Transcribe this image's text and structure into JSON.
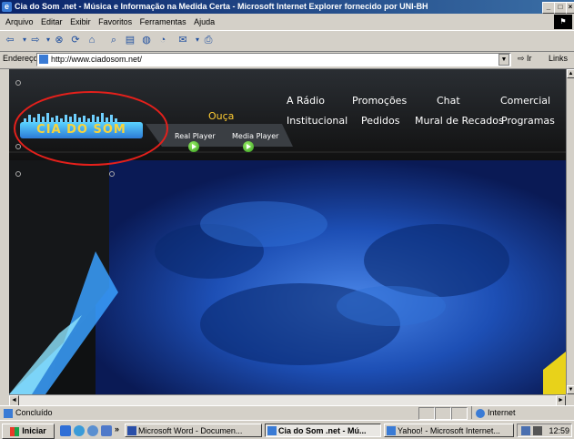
{
  "window": {
    "title": "Cia do Som .net - Música e Informação na Medida Certa - Microsoft Internet Explorer fornecido por UNI-BH",
    "buttons": [
      "_",
      "□",
      "×"
    ]
  },
  "menu": [
    "Arquivo",
    "Editar",
    "Exibir",
    "Favoritos",
    "Ferramentas",
    "Ajuda"
  ],
  "address": {
    "label": "Endereço",
    "url": "http://www.ciadosom.net/",
    "go": "Ir",
    "links": "Links"
  },
  "site": {
    "nav_row1": [
      "A Rádio",
      "Promoções",
      "Chat",
      "Comercial"
    ],
    "nav_row2": [
      "Institucional",
      "Pedidos",
      "Mural de Recados",
      "Programas"
    ],
    "listen_label": "Ouça",
    "players": [
      "Real Player",
      "Media Player"
    ],
    "logo_text": "CIA DO SOM",
    "colors": {
      "ouca": "#ffcc33",
      "annotation_circle": "#e5201b",
      "banner": "#1d4fb5"
    }
  },
  "status": {
    "text": "Concluído",
    "zone": "Internet"
  },
  "taskbar": {
    "start": "Iniciar",
    "more": "»",
    "tasks": [
      {
        "label": "Microsoft Word - Documen...",
        "active": false
      },
      {
        "label": "Cia do Som .net - Mú...",
        "active": true
      },
      {
        "label": "Yahoo! - Microsoft Internet...",
        "active": false
      }
    ],
    "clock": "12:59"
  }
}
